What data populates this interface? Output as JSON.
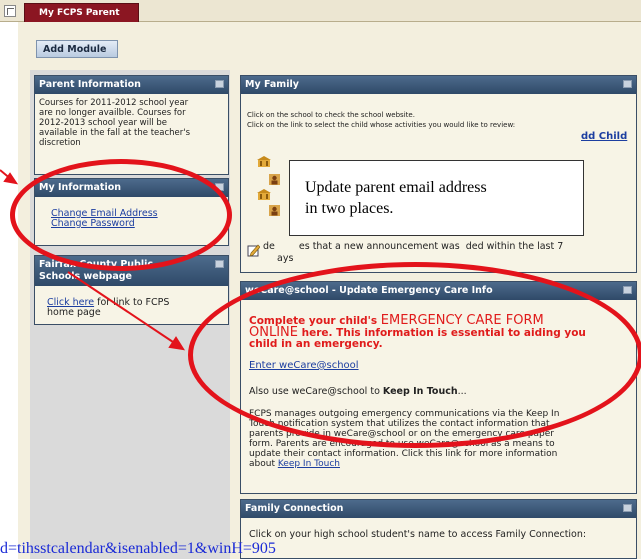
{
  "topbar": {
    "tab_label": "My FCPS Parent"
  },
  "toolbar": {
    "add_module_label": "Add Module"
  },
  "parent_info": {
    "title": "Parent Information",
    "lines": [
      "Courses for 2011-2012 school year",
      "are no longer availble. Courses for",
      "2012-2013 school year will be",
      "available in the fall at the teacher's",
      "discretion"
    ]
  },
  "my_information": {
    "title": "My Information",
    "change_email": "Change Email Address",
    "change_password": "Change Password"
  },
  "fcps_panel": {
    "title_line1": "Fairfax County Public",
    "title_line2": "Schools webpage",
    "click_here": "Click here",
    "text_rest": " for link to FCPS",
    "text_line2": "home page"
  },
  "my_family": {
    "title": "My Family",
    "line1": "Click on the school to check the school website.",
    "line2": "Click on the link to select the child whose activities you would like to review:",
    "add_child": "dd Child",
    "announcement_1": "de",
    "announcement_2": "es that a new announcement was",
    "announcement_3": "ded within the last 7",
    "announcement_line2": "ays"
  },
  "callout": {
    "line1": "Update parent email address",
    "line2": "in two places."
  },
  "wecare": {
    "title": "weCare@school - Update Emergency Care Info",
    "red_line1_a": "Complete your child's ",
    "red_line1_b": "EMERGENCY CARE FORM",
    "red_line2_a": "ONLINE",
    "red_line2_b": " here. This information is essential to aiding you",
    "red_line3": "child in an emergency.",
    "enter_link": "Enter weCare@school",
    "also_use_a": "Also use weCare@school to ",
    "also_use_b": "Keep In Touch",
    "also_use_c": "...",
    "para_lines": [
      "FCPS manages outgoing emergency communications via the Keep In",
      "Touch notification system that utilizes the contact information that",
      "parents provide in weCare@school or on the emergency care paper",
      "form. Parents are encouraged to use weCare@school as a means to",
      "update their contact information. Click this link for more information"
    ],
    "about_prefix": "about ",
    "keep_in_touch_link": "Keep In Touch"
  },
  "family_connection": {
    "title": "Family Connection",
    "line1": "Click on your high school student's name to access Family Connection:"
  },
  "bottom_url": "d=tihsstcalendar&isenabled=1&winH=905",
  "colors": {
    "accent_red": "#e3131b",
    "panel_header": "#2f4968",
    "tab_maroon": "#8b1622"
  }
}
